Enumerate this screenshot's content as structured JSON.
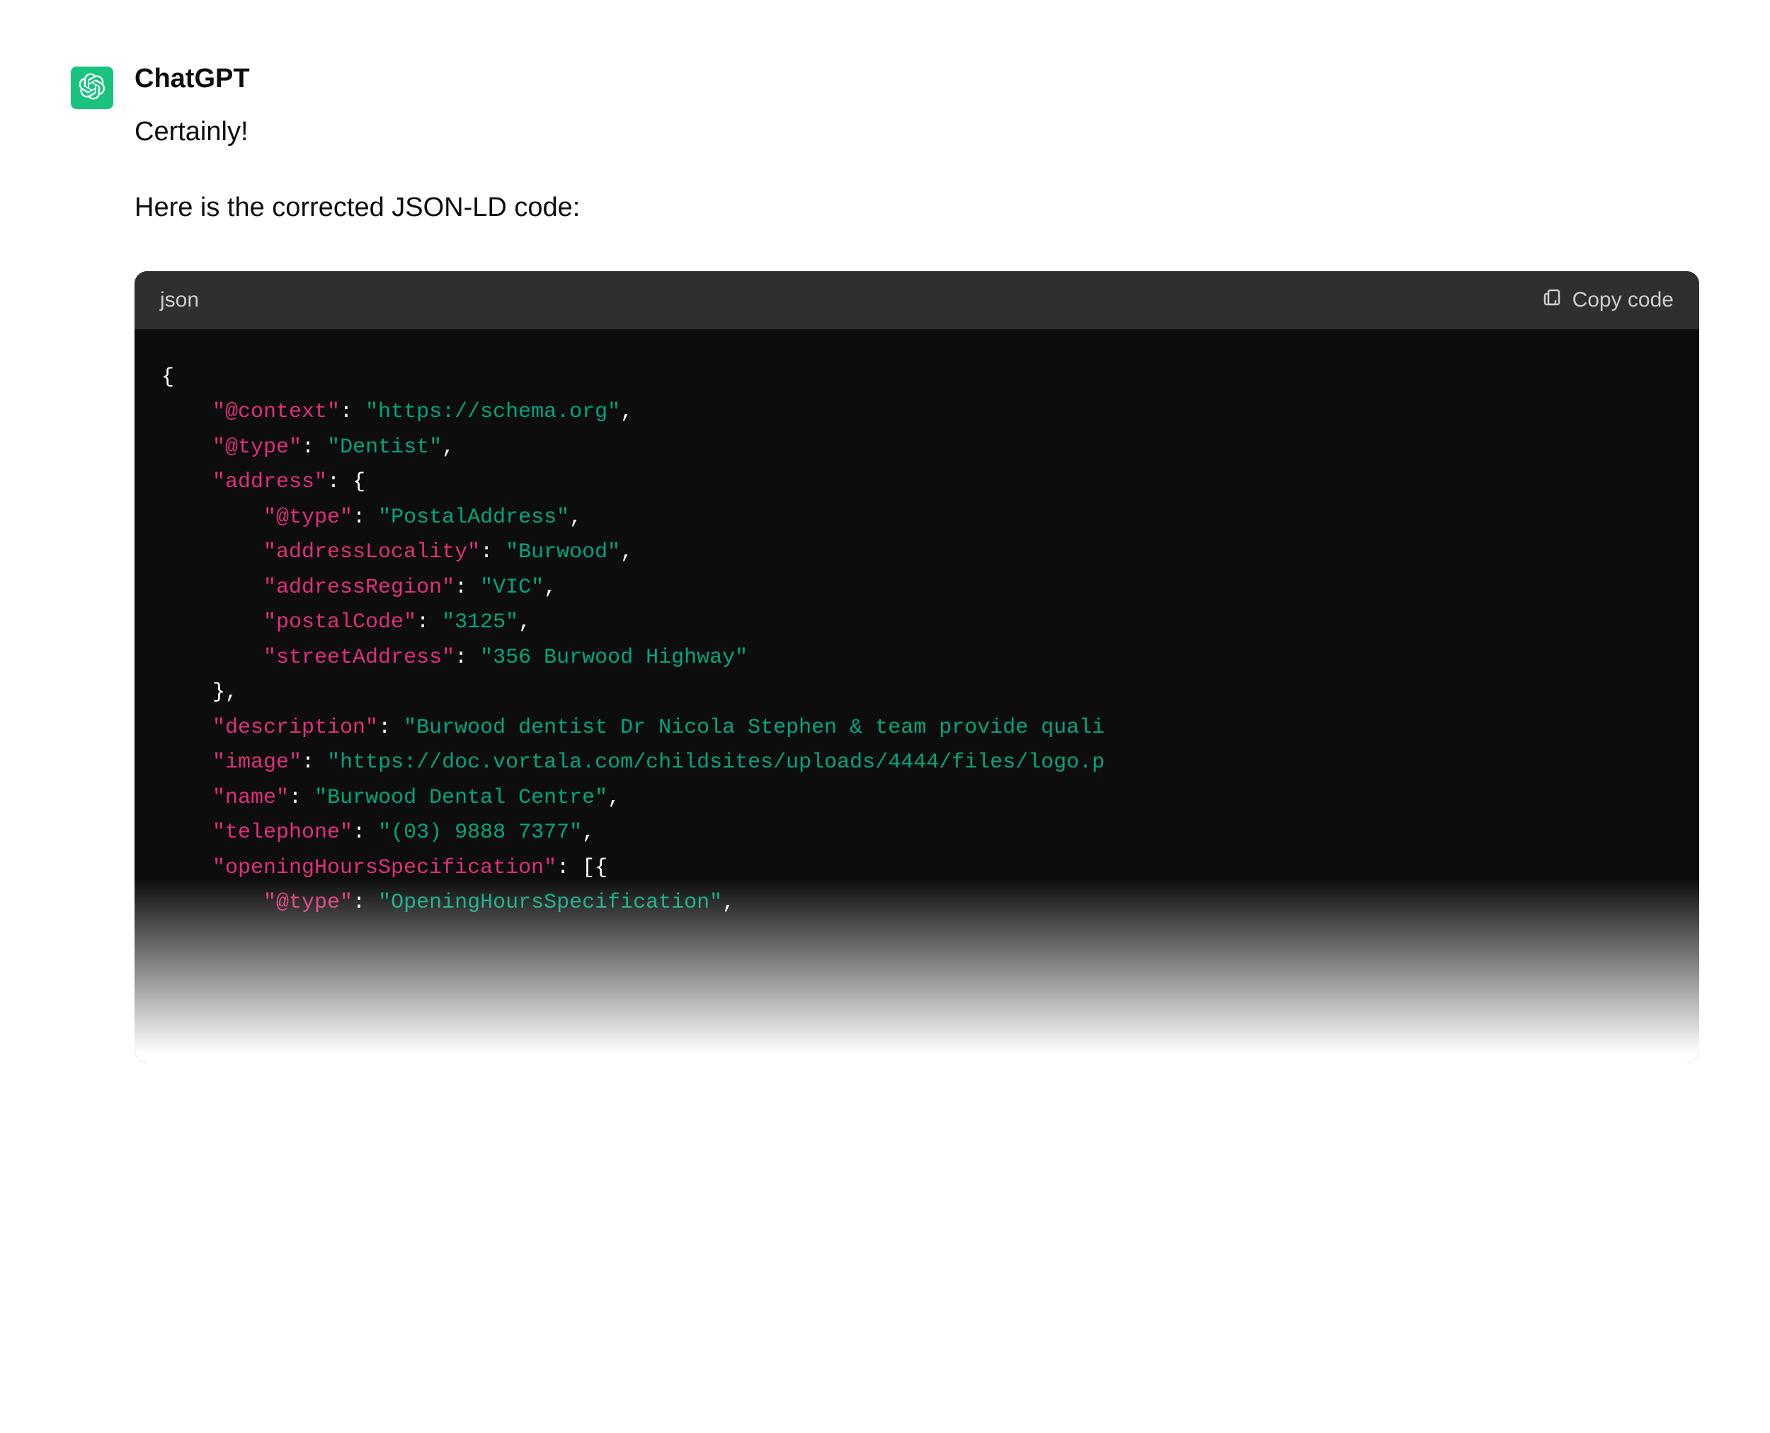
{
  "author": "ChatGPT",
  "avatar": {
    "name": "openai-logo",
    "bg": "#19c37d"
  },
  "response": {
    "line1": "Certainly!",
    "line2": "Here is the corrected JSON-LD code:"
  },
  "code": {
    "language": "json",
    "copy_label": "Copy code",
    "tokens": [
      [
        [
          "p",
          "{"
        ]
      ],
      [
        [
          "p",
          "    "
        ],
        [
          "k",
          "\"@context\""
        ],
        [
          "p",
          ": "
        ],
        [
          "s",
          "\"https://schema.org\""
        ],
        [
          "p",
          ","
        ]
      ],
      [
        [
          "p",
          "    "
        ],
        [
          "k",
          "\"@type\""
        ],
        [
          "p",
          ": "
        ],
        [
          "s",
          "\"Dentist\""
        ],
        [
          "p",
          ","
        ]
      ],
      [
        [
          "p",
          "    "
        ],
        [
          "k",
          "\"address\""
        ],
        [
          "p",
          ": {"
        ]
      ],
      [
        [
          "p",
          "        "
        ],
        [
          "k",
          "\"@type\""
        ],
        [
          "p",
          ": "
        ],
        [
          "s",
          "\"PostalAddress\""
        ],
        [
          "p",
          ","
        ]
      ],
      [
        [
          "p",
          "        "
        ],
        [
          "k",
          "\"addressLocality\""
        ],
        [
          "p",
          ": "
        ],
        [
          "s",
          "\"Burwood\""
        ],
        [
          "p",
          ","
        ]
      ],
      [
        [
          "p",
          "        "
        ],
        [
          "k",
          "\"addressRegion\""
        ],
        [
          "p",
          ": "
        ],
        [
          "s",
          "\"VIC\""
        ],
        [
          "p",
          ","
        ]
      ],
      [
        [
          "p",
          "        "
        ],
        [
          "k",
          "\"postalCode\""
        ],
        [
          "p",
          ": "
        ],
        [
          "s",
          "\"3125\""
        ],
        [
          "p",
          ","
        ]
      ],
      [
        [
          "p",
          "        "
        ],
        [
          "k",
          "\"streetAddress\""
        ],
        [
          "p",
          ": "
        ],
        [
          "s",
          "\"356 Burwood Highway\""
        ]
      ],
      [
        [
          "p",
          "    },"
        ]
      ],
      [
        [
          "p",
          "    "
        ],
        [
          "k",
          "\"description\""
        ],
        [
          "p",
          ": "
        ],
        [
          "s",
          "\"Burwood dentist Dr Nicola Stephen & team provide quali"
        ]
      ],
      [
        [
          "p",
          "    "
        ],
        [
          "k",
          "\"image\""
        ],
        [
          "p",
          ": "
        ],
        [
          "s",
          "\"https://doc.vortala.com/childsites/uploads/4444/files/logo.p"
        ]
      ],
      [
        [
          "p",
          "    "
        ],
        [
          "k",
          "\"name\""
        ],
        [
          "p",
          ": "
        ],
        [
          "s",
          "\"Burwood Dental Centre\""
        ],
        [
          "p",
          ","
        ]
      ],
      [
        [
          "p",
          "    "
        ],
        [
          "k",
          "\"telephone\""
        ],
        [
          "p",
          ": "
        ],
        [
          "s",
          "\"(03) 9888 7377\""
        ],
        [
          "p",
          ","
        ]
      ],
      [
        [
          "p",
          "    "
        ],
        [
          "k",
          "\"openingHoursSpecification\""
        ],
        [
          "p",
          ": [{"
        ]
      ],
      [
        [
          "p",
          "        "
        ],
        [
          "k",
          "\"@type\""
        ],
        [
          "p",
          ": "
        ],
        [
          "s",
          "\"OpeningHoursSpecification\""
        ],
        [
          "p",
          ","
        ]
      ]
    ]
  }
}
